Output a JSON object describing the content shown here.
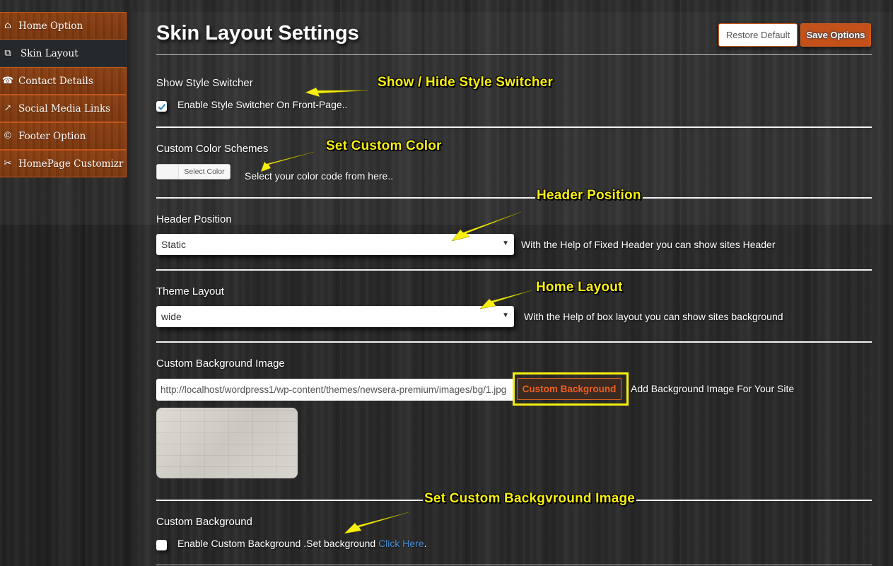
{
  "sidebar": {
    "items": [
      {
        "label": "Home Option",
        "icon": "home-icon",
        "glyph": "⌂",
        "active": false
      },
      {
        "label": "Skin Layout",
        "icon": "layout-icon",
        "glyph": "⧉",
        "active": true
      },
      {
        "label": "Contact Details",
        "icon": "phone-icon",
        "glyph": "☎",
        "active": false
      },
      {
        "label": "Social Media Links",
        "icon": "share-icon",
        "glyph": "↗",
        "active": false
      },
      {
        "label": "Footer Option",
        "icon": "copyright-icon",
        "glyph": "©",
        "active": false
      },
      {
        "label": "HomePage Customizr",
        "icon": "scissors-icon",
        "glyph": "✂",
        "active": false
      }
    ]
  },
  "header": {
    "title": "Skin Layout Settings",
    "restore_label": "Restore Default",
    "save_label": "Save Options"
  },
  "sections": {
    "style_switcher": {
      "label": "Show Style Switcher",
      "checkbox_label": "Enable Style Switcher On Front-Page..",
      "checked": true
    },
    "color_scheme": {
      "label": "Custom Color Schemes",
      "button_label": "Select Color",
      "description": "Select your color code from here.."
    },
    "header_position": {
      "label": "Header Position",
      "selected": "Static",
      "description": "With the Help of Fixed Header you can show sites Header"
    },
    "theme_layout": {
      "label": "Theme Layout",
      "selected": "wide",
      "description": "With the Help of box layout you can show sites background"
    },
    "background_image": {
      "label": "Custom Background Image",
      "url_value": "http://localhost/wordpress1/wp-content/themes/newsera-premium/images/bg/1.jpg",
      "button_label": "Custom Background",
      "description": "Add Background Image For Your Site"
    },
    "custom_background": {
      "label": "Custom Background",
      "checkbox_label": "Enable Custom Background .Set background ",
      "link_label": "Click Here",
      "suffix": ".",
      "checked": false
    }
  },
  "annotations": {
    "style_switcher": "Show / Hide Style Switcher",
    "custom_color": "Set Custom Color",
    "header_position": "Header Position",
    "home_layout": "Home Layout",
    "background_image": "Set Custom Backgvround Image"
  },
  "colors": {
    "accent": "#c4511a",
    "sidebar_bg": "#7a360e",
    "annotation": "#f8ef10",
    "link": "#4a8fd6"
  }
}
